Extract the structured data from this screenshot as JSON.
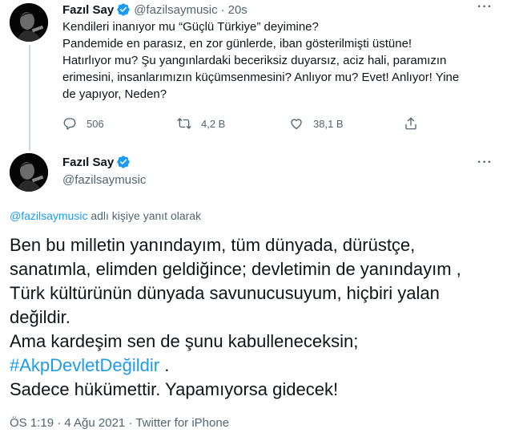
{
  "tweet1": {
    "name": "Fazıl Say",
    "handle": "@fazilsaymusic",
    "separator": "·",
    "time": "20s",
    "more": "···",
    "lines": [
      "Kendileri inanıyor mu “Güçlü Türkiye” deyimine?",
      "Pandemide en parasız, en zor günlerde, iban gösterilmişti üstüne!",
      "Hatırlıyor mu? Şu yangınlardaki beceriksiz duyarsız, aciz hali, paramızın",
      "erimesini, insanlarımızın küçümsenmesini? Anlıyor mu? Evet! Anlıyor! Yine",
      "de yapıyor, Neden?"
    ],
    "reply_count": "506",
    "retweet_count": "4,2 B",
    "like_count": "38,1 B"
  },
  "tweet2": {
    "name": "Fazıl Say",
    "handle": "@fazilsaymusic",
    "more": "···",
    "reply_mention": "@fazilsaymusic",
    "reply_suffix": " adlı kişiye yanıt olarak",
    "lines": [
      "Ben bu milletin yanındayım, tüm dünyada, dürüstçe,",
      "sanatımla, elimden geldiğince; devletimin de yanındayım ,",
      "Türk kültürünün dünyada savunucusuyum, hiçbiri yalan",
      "değildir.",
      "Ama kardeşim sen de şunu kabulleneceksin;"
    ],
    "hashtag": "#AkpDevletDeğildir",
    "hashtag_suffix": " .",
    "last_line": "Sadece hükümettir. Yapamıyorsa gidecek!",
    "meta": "ÖS 1:19 · 4 Ağu 2021 · Twitter for iPhone"
  },
  "colors": {
    "accent": "#1d9bf0",
    "secondary_text": "#536471",
    "primary_text": "#0f1419",
    "thread_line": "#cfd9de"
  },
  "icons": {
    "verified": "verified-badge-icon",
    "reply": "reply-icon",
    "retweet": "retweet-icon",
    "like": "heart-icon",
    "share": "share-icon"
  }
}
